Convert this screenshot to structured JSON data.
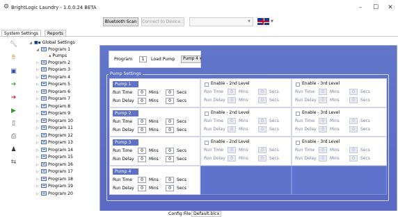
{
  "window": {
    "title": "BrightLogic Laundry - 1.0.0.24 BETA",
    "app_icon": "gear-icon",
    "controls": {
      "minimize": "–",
      "maximize": "☐",
      "close": "✕"
    }
  },
  "toolbar": {
    "bluetooth_scan": "Bluetooth Scan",
    "connect": "Connect to Device...",
    "device_combo_value": "",
    "language_flag": "uk-flag-icon"
  },
  "tabs": [
    {
      "label": "System Settings",
      "active": true
    },
    {
      "label": "Reports",
      "active": false
    }
  ],
  "sidebar_icons": [
    "wrench-icon",
    "hand-icon",
    "save-icon",
    "green-arrow-right-icon",
    "red-arrow-right-icon",
    "green-play-icon",
    "document-icon",
    "printer-icon",
    "user-icon",
    "transfer-icon"
  ],
  "tree": {
    "root": "Global Settings",
    "items": [
      "Program 1",
      "Pumps",
      "Program 2",
      "Program 3",
      "Program 4",
      "Program 5",
      "Program 6",
      "Program 7",
      "Program 8",
      "Program 9",
      "Program 10",
      "Program 11",
      "Program 12",
      "Program 13",
      "Program 14",
      "Program 15",
      "Program 16",
      "Program 17",
      "Program 18",
      "Program 19",
      "Program 20"
    ]
  },
  "program_bar": {
    "program_label": "Program",
    "program_value": "1",
    "load_pump_label": "Load Pump",
    "load_pump_value": "Pump 4"
  },
  "pump_settings": {
    "legend": "Pump Settings",
    "labels": {
      "run_time": "Run Time",
      "run_delay": "Run Delay",
      "mins": "Mins",
      "secs": "Secs",
      "enable_2nd": "Enable - 2nd Level",
      "enable_3rd": "Enable - 3rd Level"
    },
    "pumps": [
      {
        "name": "Pump 1",
        "run_time_mins": "0",
        "run_time_secs": "0",
        "run_delay_mins": "0",
        "run_delay_secs": "0",
        "l2_run_time_mins": "0",
        "l2_run_time_secs": "0",
        "l2_run_delay_mins": "0",
        "l2_run_delay_secs": "0",
        "l3_run_time_mins": "0",
        "l3_run_time_secs": "0",
        "l3_run_delay_mins": "0",
        "l3_run_delay_secs": "0"
      },
      {
        "name": "Pump 2",
        "run_time_mins": "0",
        "run_time_secs": "0",
        "run_delay_mins": "0",
        "run_delay_secs": "0",
        "l2_run_time_mins": "0",
        "l2_run_time_secs": "0",
        "l2_run_delay_mins": "0",
        "l2_run_delay_secs": "0",
        "l3_run_time_mins": "0",
        "l3_run_time_secs": "0",
        "l3_run_delay_mins": "0",
        "l3_run_delay_secs": "0"
      },
      {
        "name": "Pump 3",
        "run_time_mins": "0",
        "run_time_secs": "0",
        "run_delay_mins": "0",
        "run_delay_secs": "0",
        "l2_run_time_mins": "0",
        "l2_run_time_secs": "0",
        "l2_run_delay_mins": "0",
        "l2_run_delay_secs": "0",
        "l3_run_time_mins": "0",
        "l3_run_time_secs": "0",
        "l3_run_delay_mins": "0",
        "l3_run_delay_secs": "0"
      },
      {
        "name": "Pump 4",
        "run_time_mins": "0",
        "run_time_secs": "0",
        "run_delay_mins": "0",
        "run_delay_secs": "0"
      }
    ]
  },
  "status": {
    "config_label": "Config File:",
    "config_value": "Default.blcx"
  },
  "colors": {
    "panel": "#5f72c7",
    "accent": "#4a6fb5"
  }
}
